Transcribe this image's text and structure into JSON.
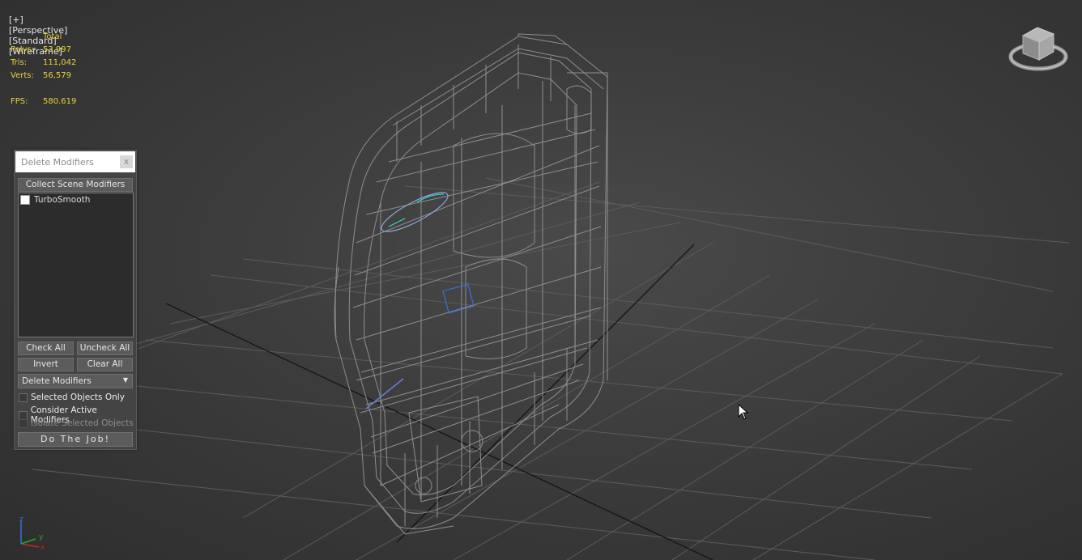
{
  "viewport": {
    "labels": [
      "[+]",
      "[Perspective]",
      "[Standard]",
      "[Wireframe]"
    ]
  },
  "stats": {
    "header": "Total",
    "rows": [
      {
        "key": "Polys:",
        "value": "53,997"
      },
      {
        "key": "Tris:",
        "value": "111,042"
      },
      {
        "key": "Verts:",
        "value": "56,579"
      }
    ],
    "fps_key": "FPS:",
    "fps_value": "580.619"
  },
  "panel": {
    "title": "Delete Modifiers",
    "close_label": "x",
    "collect_button": "Collect Scene Modifiers",
    "modifiers": [
      {
        "label": "TurboSmooth",
        "checked": true
      }
    ],
    "check_all": "Check All",
    "uncheck_all": "Uncheck All",
    "invert": "Invert",
    "clear_all": "Clear All",
    "mode_dropdown": "Delete Modifiers",
    "options": {
      "selected_only": "Selected Objects Only",
      "consider_active": "Consider Active Modifiers",
      "isolate_selected": "Isolate Selected Objects"
    },
    "do_job": "Do The Job!"
  },
  "axis": {
    "z": "z",
    "x": "x",
    "y": "y"
  },
  "colors": {
    "stats_text": "#e8d23a",
    "wire": "#8c8c8c",
    "grid": "#5a5a5a",
    "axis_x": "#cc2222",
    "axis_y": "#22aa22",
    "axis_z": "#3a6fd8"
  }
}
